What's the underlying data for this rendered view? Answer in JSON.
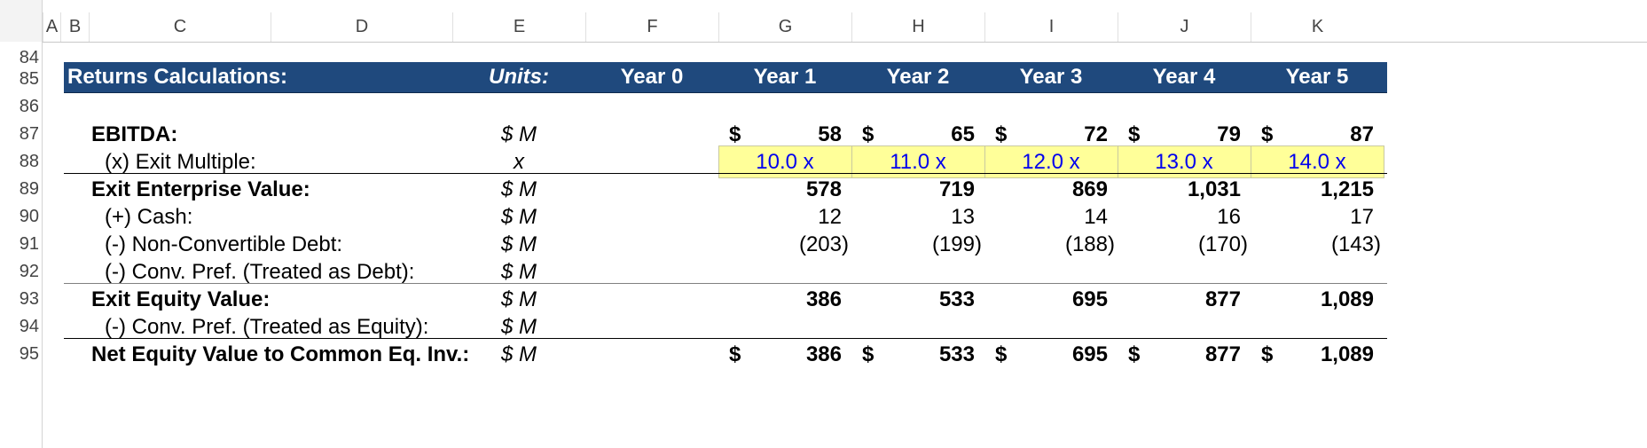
{
  "column_headers": [
    "A",
    "B",
    "C",
    "D",
    "E",
    "F",
    "G",
    "H",
    "I",
    "J",
    "K"
  ],
  "row_numbers": [
    "84",
    "85",
    "86",
    "87",
    "88",
    "89",
    "90",
    "91",
    "92",
    "93",
    "94",
    "95"
  ],
  "header": {
    "title": "Returns Calculations:",
    "units": "Units:",
    "years": [
      "Year 0",
      "Year 1",
      "Year 2",
      "Year 3",
      "Year 4",
      "Year 5"
    ]
  },
  "rows": [
    {
      "label": "EBITDA:",
      "unit": "$ M",
      "values": [
        "",
        "58",
        "65",
        "72",
        "79",
        "87"
      ],
      "dollar": "$"
    },
    {
      "label": "(x) Exit Multiple:",
      "unit": "x",
      "values": [
        "",
        "10.0 x",
        "11.0 x",
        "12.0 x",
        "13.0 x",
        "14.0 x"
      ]
    },
    {
      "label": "Exit Enterprise Value:",
      "unit": "$ M",
      "values": [
        "",
        "578",
        "719",
        "869",
        "1,031",
        "1,215"
      ]
    },
    {
      "label": "(+) Cash:",
      "unit": "$ M",
      "values": [
        "",
        "12",
        "13",
        "14",
        "16",
        "17"
      ]
    },
    {
      "label": "(-) Non-Convertible Debt:",
      "unit": "$ M",
      "values": [
        "",
        "(203)",
        "(199)",
        "(188)",
        "(170)",
        "(143)"
      ]
    },
    {
      "label": "(-) Conv. Pref. (Treated as Debt):",
      "unit": "$ M",
      "values": [
        "",
        "",
        "",
        "",
        "",
        ""
      ]
    },
    {
      "label": "Exit Equity Value:",
      "unit": "$ M",
      "values": [
        "",
        "386",
        "533",
        "695",
        "877",
        "1,089"
      ]
    },
    {
      "label": "(-) Conv. Pref. (Treated as Equity):",
      "unit": "$ M",
      "values": [
        "",
        "",
        "",
        "",
        "",
        ""
      ]
    },
    {
      "label": "Net Equity Value to Common Eq. Inv.:",
      "unit": "$ M",
      "values": [
        "",
        "386",
        "533",
        "695",
        "877",
        "1,089"
      ],
      "dollar": "$"
    }
  ],
  "colors": {
    "header_band": "#1f497d",
    "input_fill": "#ffff99",
    "input_text": "#0000ee"
  }
}
